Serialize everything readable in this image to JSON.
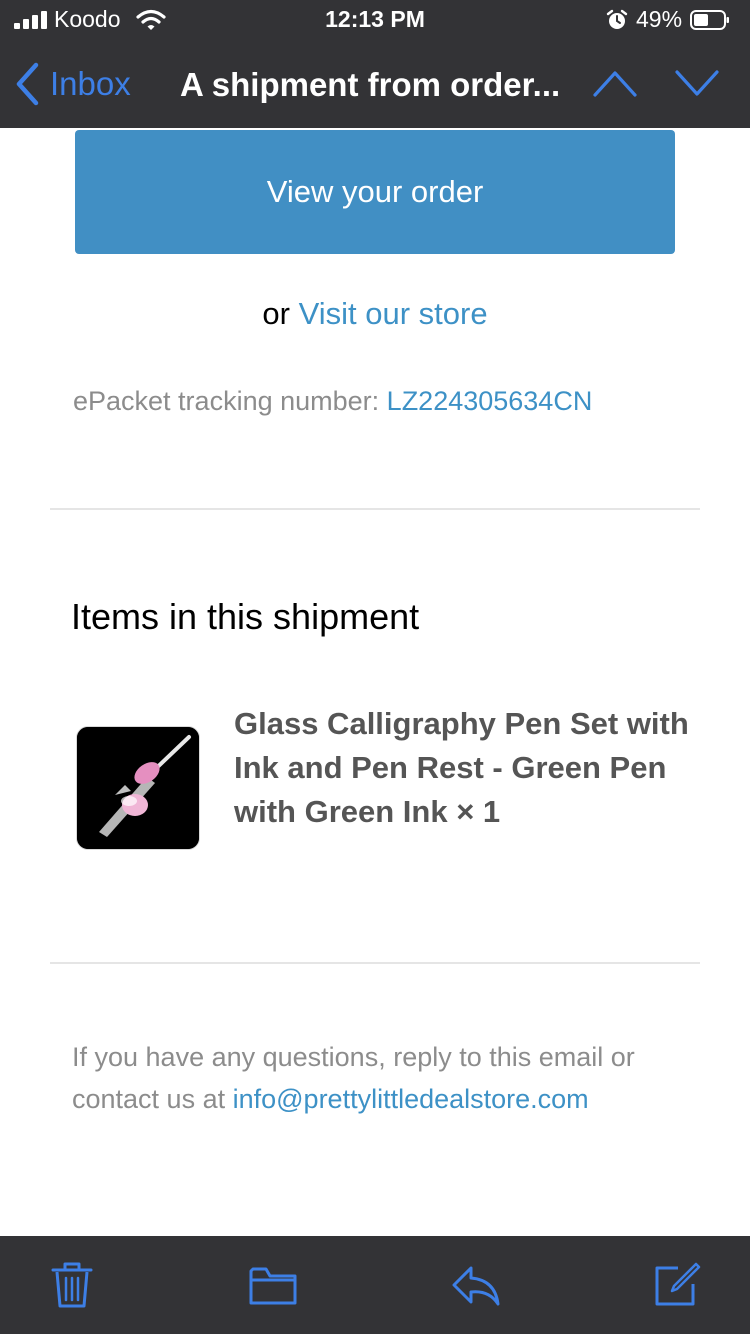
{
  "status_bar": {
    "carrier": "Koodo",
    "time": "12:13 PM",
    "battery_percent": "49%",
    "battery_level": 0.49
  },
  "nav": {
    "back_label": "Inbox",
    "title": "A shipment from order..."
  },
  "email": {
    "view_order_button": "View your order",
    "or_text": "or",
    "visit_store_link": "Visit our store",
    "tracking_label": "ePacket tracking number:",
    "tracking_number": "LZ224305634CN",
    "items_heading": "Items in this shipment",
    "items": [
      {
        "name": "Glass Calligraphy Pen Set with Ink and Pen Rest - Green Pen with Green Ink × 1"
      }
    ],
    "footer_text": "If you have any questions, reply to this email or contact us at",
    "footer_email": "info@prettylittledealstore.com"
  },
  "toolbar": {
    "icons": [
      "trash-icon",
      "folder-icon",
      "reply-icon",
      "compose-icon"
    ]
  },
  "colors": {
    "accent": "#3d7fe6",
    "link": "#3d91c6",
    "button": "#418fc4",
    "bar_background": "#333336"
  }
}
